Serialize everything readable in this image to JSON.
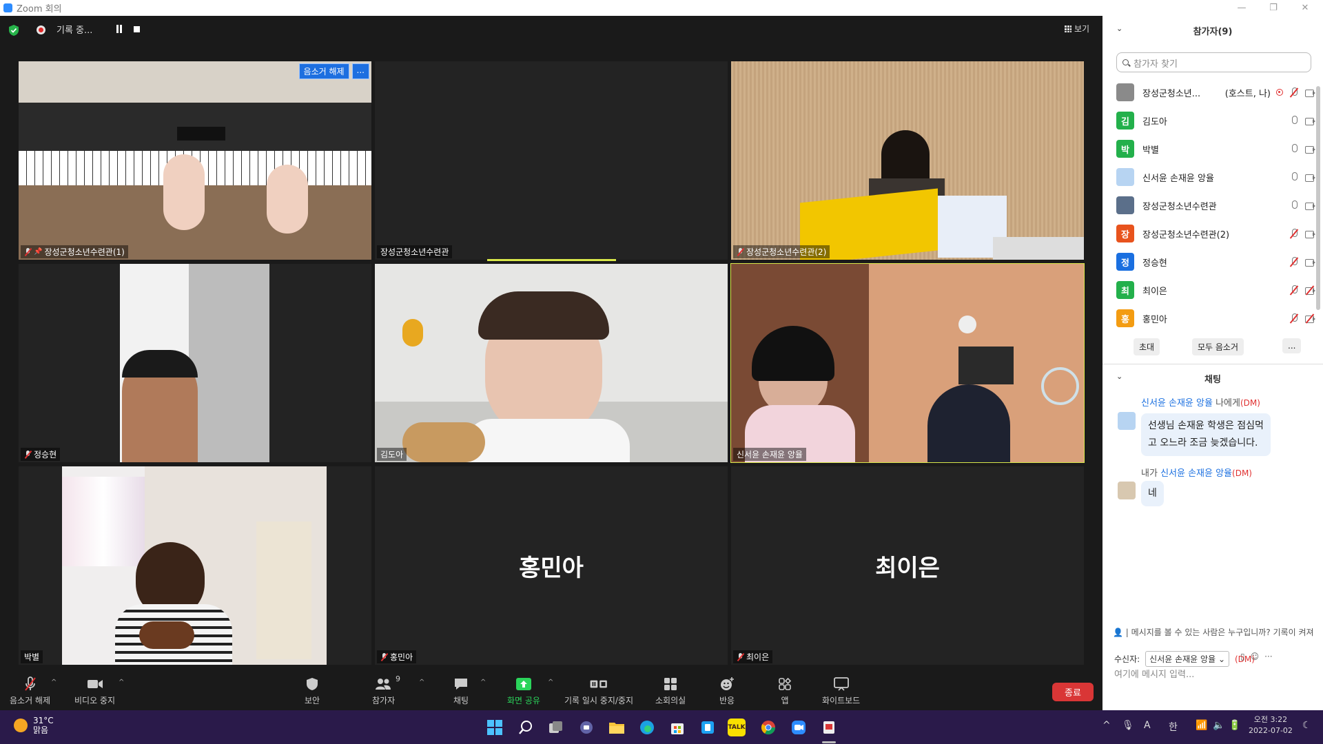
{
  "window": {
    "title": "Zoom 회의"
  },
  "top": {
    "recording_label": "기록 중...",
    "view_label": "보기"
  },
  "tiles": [
    {
      "name": "장성군청소년수련관(1)",
      "muted": true,
      "pinned": true,
      "controls": {
        "unmute": "음소거 해제",
        "more": "..."
      }
    },
    {
      "name": "장성군청소년수련관",
      "muted": false
    },
    {
      "name": "장성군청소년수련관(2)",
      "muted": true
    },
    {
      "name": "정승현",
      "muted": true
    },
    {
      "name": "김도아",
      "muted": false
    },
    {
      "name": "신서윤 손재윤 앙율",
      "muted": false,
      "active": true
    },
    {
      "name": "박별",
      "muted": false
    },
    {
      "name": "홍민아",
      "muted": true,
      "big_name": "홍민아"
    },
    {
      "name": "최이은",
      "muted": true,
      "big_name": "최이은"
    }
  ],
  "toolbar": {
    "unmute": "음소거 해제",
    "stop_video": "비디오 중지",
    "security": "보안",
    "participants": "참가자",
    "participants_count": "9",
    "chat": "채팅",
    "share_screen": "화면 공유",
    "pause_stop_recording": "기록 일시 중지/중지",
    "breakout": "소회의실",
    "reactions": "반응",
    "apps": "앱",
    "whiteboard": "화이트보드",
    "end": "종료"
  },
  "panel": {
    "participants_title": "참가자(9)",
    "search_placeholder": "참가자 찾기",
    "participants": [
      {
        "name": "장성군청소년...",
        "tag": "(호스트, 나)",
        "avatar": "",
        "avatar_color": "#8a8a8a",
        "mic_off": true,
        "cam_off": false,
        "recording": true
      },
      {
        "name": "김도아",
        "avatar": "김",
        "avatar_color": "#23b04b",
        "mic_off": false,
        "cam_off": false
      },
      {
        "name": "박별",
        "avatar": "박",
        "avatar_color": "#23b04b",
        "mic_off": false,
        "cam_off": false
      },
      {
        "name": "신서윤 손재윤 앙율",
        "avatar": "",
        "avatar_color": "#b7d4f2",
        "mic_off": false,
        "cam_off": false
      },
      {
        "name": "장성군청소년수련관",
        "avatar": "",
        "avatar_color": "#5b6f8a",
        "mic_off": false,
        "cam_off": false
      },
      {
        "name": "장성군청소년수련관(2)",
        "avatar": "장",
        "avatar_color": "#e8531d",
        "mic_off": true,
        "cam_off": false
      },
      {
        "name": "정승현",
        "avatar": "정",
        "avatar_color": "#1a6fe0",
        "mic_off": true,
        "cam_off": false
      },
      {
        "name": "최이은",
        "avatar": "최",
        "avatar_color": "#23b04b",
        "mic_off": true,
        "cam_off": true
      },
      {
        "name": "홍민아",
        "avatar": "홍",
        "avatar_color": "#f39c12",
        "mic_off": true,
        "cam_off": true
      }
    ],
    "invite": "초대",
    "mute_all": "모두 음소거",
    "more": "...",
    "chat_title": "채팅",
    "messages": [
      {
        "from": "신서윤 손재윤 앙율",
        "to": "나에게",
        "dm": "(DM)",
        "text_line1": "선생님 손재윤 학생은 점심먹",
        "text_line2": "고 오느라 조금 늦겠습니다."
      },
      {
        "from": "내가",
        "to": "신서윤 손재윤 앙율",
        "dm": "(DM)",
        "text_line1": "네"
      }
    ],
    "notice": "| 메시지를 볼 수 있는 사람은 누구입니까? 기록이 켜져",
    "recipient_label": "수신자:",
    "recipient": "신서윤 손재윤 앙율",
    "recipient_dm": "(DM)",
    "input_placeholder": "여기에 메시지 입력..."
  },
  "taskbar": {
    "temp": "31°C",
    "weather": "맑음",
    "ime": "한",
    "font_a": "A",
    "time": "오전 3:22",
    "date": "2022-07-02"
  }
}
